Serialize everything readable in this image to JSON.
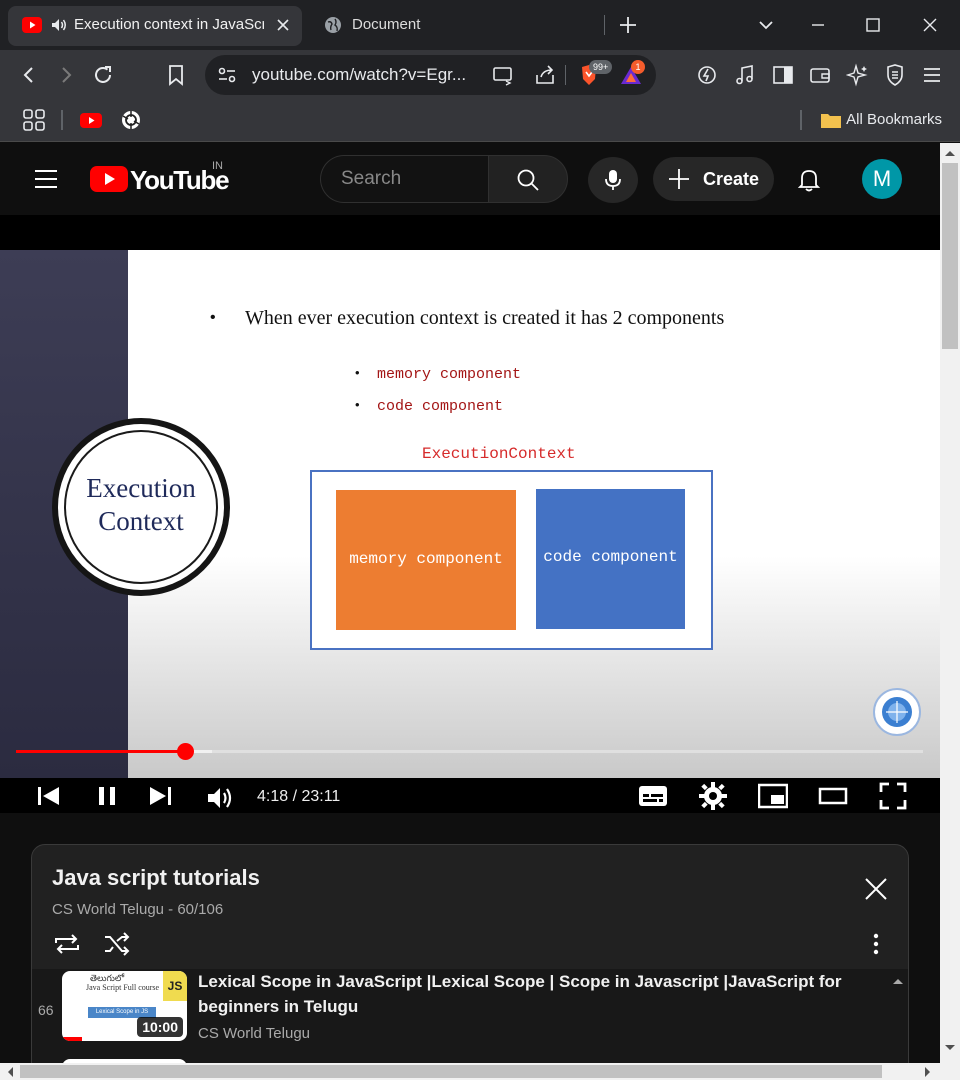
{
  "browser": {
    "tabs": [
      {
        "title": "Execution context in JavaScript",
        "active": true
      },
      {
        "title": "Document",
        "active": false
      }
    ],
    "url": "youtube.com/watch?v=Egr...",
    "brave_badge": "99+",
    "rewards_badge": "1",
    "bookmarks_label": "All Bookmarks"
  },
  "youtube": {
    "logo_text": "YouTube",
    "country_code": "IN",
    "search_placeholder": "Search",
    "create_label": "Create",
    "avatar_letter": "M"
  },
  "slide": {
    "bullet_main": "When ever execution context is created it has 2 components",
    "sub_bullets": [
      "memory component",
      "code component"
    ],
    "circle_line1": "Execution",
    "circle_line2": "Context",
    "diagram_title": "ExecutionContext",
    "memory_box": "memory component",
    "code_box": "code component"
  },
  "player": {
    "time": "4:18 / 23:11",
    "progress_fraction": 0.186,
    "buffered_fraction": 0.216
  },
  "playlist": {
    "title": "Java script tutorials",
    "subtitle": "CS World Telugu - 60/106",
    "items": [
      {
        "index": "66",
        "title": "Lexical Scope in JavaScript |Lexical Scope | Scope in Javascript |JavaScript for beginners in Telugu",
        "channel": "CS World Telugu",
        "duration": "10:00",
        "thumb_line1": "తెలుగులో",
        "thumb_line2": "Java Script Full course",
        "thumb_tag": "Lexical Scope in JS",
        "thumb_badge": "JS"
      }
    ]
  },
  "colors": {
    "accent": "#ff0000",
    "memory_box": "#ed7d31",
    "code_box": "#4472c4",
    "avatar": "#0097a7"
  },
  "icons": [
    "youtube-favicon",
    "speaker-icon",
    "close-icon",
    "globe-icon",
    "plus-icon",
    "chevron-down-icon",
    "minimize-icon",
    "maximize-icon",
    "back-icon",
    "forward-icon",
    "reload-icon",
    "bookmark-icon",
    "site-settings-icon",
    "cast-icon",
    "share-icon",
    "brave-shield-icon",
    "rewards-icon",
    "leo-icon",
    "music-icon",
    "sidebar-icon",
    "wallet-icon",
    "ai-icon",
    "vpn-icon",
    "menu-icon",
    "apps-icon",
    "openai-icon",
    "folder-icon",
    "hamburger-icon",
    "search-icon",
    "mic-icon",
    "bell-icon",
    "prev-icon",
    "pause-icon",
    "next-icon",
    "volume-icon",
    "subtitles-icon",
    "settings-icon",
    "miniplayer-icon",
    "theater-icon",
    "fullscreen-icon",
    "loop-icon",
    "shuffle-icon",
    "more-icon"
  ]
}
